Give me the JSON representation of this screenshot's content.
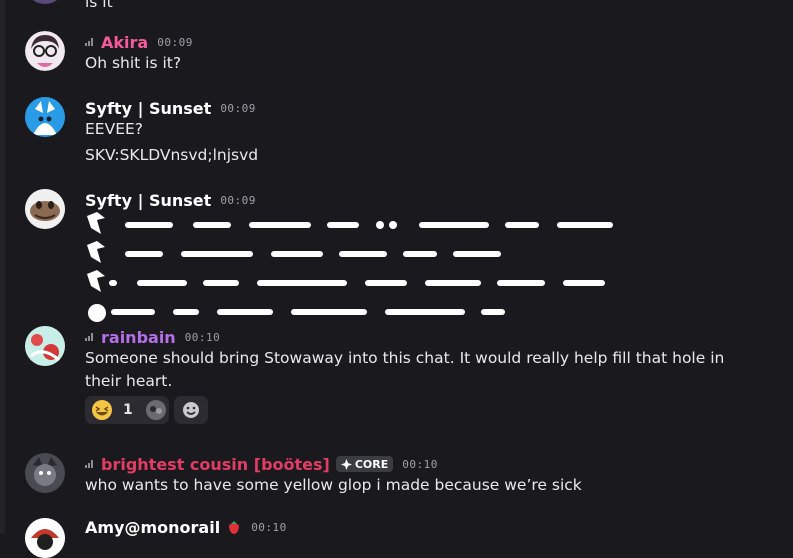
{
  "colors": {
    "background": "#1a1a1e",
    "akira_name": "#f55a9a",
    "rainbain_name": "#b46ee8",
    "cousin_name": "#e23c63",
    "white_name": "#ffffff",
    "timestamp": "#9ea0a6"
  },
  "partial_top": {
    "text": "is it"
  },
  "messages": [
    {
      "id": "akira",
      "username": "Akira",
      "time": "00:09",
      "lines": [
        "Oh shit is it?"
      ],
      "icon": "signal-icon"
    },
    {
      "id": "sunset1",
      "username": "Syfty | Sunset",
      "time": "00:09",
      "lines": [
        "EEVEE?",
        "SKV:SKLDVnsvd;lnjsvd"
      ]
    },
    {
      "id": "sunset2",
      "username": "Syfty | Sunset",
      "time": "00:09",
      "note": "four lines of unreadable custom glyph text"
    },
    {
      "id": "rainbain",
      "username": "rainbain",
      "time": "00:10",
      "text": "Someone should bring Stowaway into this chat. It would really help fill that hole in their heart.",
      "icon": "signal-icon",
      "reactions": [
        {
          "emoji": "grinning-squinting-face-icon",
          "count": "1"
        },
        {
          "emoji": "custom-avatar-emoji-icon",
          "count": ""
        },
        {
          "emoji": "add-reaction-icon",
          "count": ""
        }
      ]
    },
    {
      "id": "cousin",
      "username": "brightest cousin [boötes]",
      "time": "00:10",
      "badge": "CORE",
      "lines": [
        "who wants to have some yellow glop i made because we’re sick"
      ],
      "icon": "signal-icon"
    },
    {
      "id": "amy",
      "username": "Amy@monorail",
      "time": "00:10",
      "icon": "strawberry-icon"
    }
  ]
}
